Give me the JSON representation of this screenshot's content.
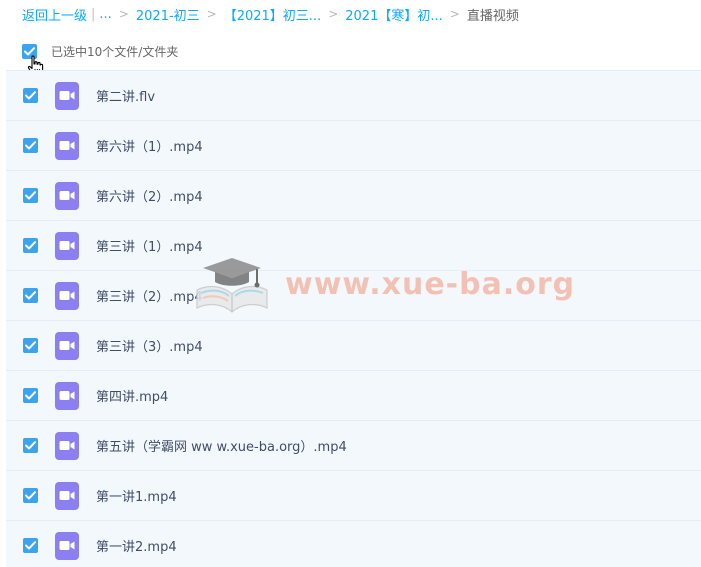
{
  "breadcrumb": {
    "back": "返回上一级",
    "separator": "|",
    "ellipsis": "...",
    "gt": ">",
    "items": [
      "2021-初三",
      "【2021】初三...",
      "2021【寒】初..."
    ],
    "current": "直播视频"
  },
  "selection": {
    "label": "已选中10个文件/文件夹",
    "checked": true
  },
  "files": [
    {
      "name": "第二讲.flv",
      "checked": true
    },
    {
      "name": "第六讲（1）.mp4",
      "checked": true
    },
    {
      "name": "第六讲（2）.mp4",
      "checked": true
    },
    {
      "name": "第三讲（1）.mp4",
      "checked": true
    },
    {
      "name": "第三讲（2）.mp4",
      "checked": true
    },
    {
      "name": "第三讲（3）.mp4",
      "checked": true
    },
    {
      "name": "第四讲.mp4",
      "checked": true
    },
    {
      "name": "第五讲（学霸网 ww w.xue-ba.org）.mp4",
      "checked": true
    },
    {
      "name": "第一讲1.mp4",
      "checked": true
    },
    {
      "name": "第一讲2.mp4",
      "checked": true
    }
  ],
  "watermark": {
    "text": "www.xue-ba.org",
    "icon": "graduation-cap-book-icon"
  },
  "icons": {
    "checkbox": "checkmark-icon",
    "file": "video-camera-icon",
    "cursor": "hand-pointer-icon"
  },
  "colors": {
    "link": "#09aaff",
    "checkbox": "#3aa4ee",
    "row_bg": "#f3f8fd",
    "video_icon": "#8b7ff2"
  }
}
